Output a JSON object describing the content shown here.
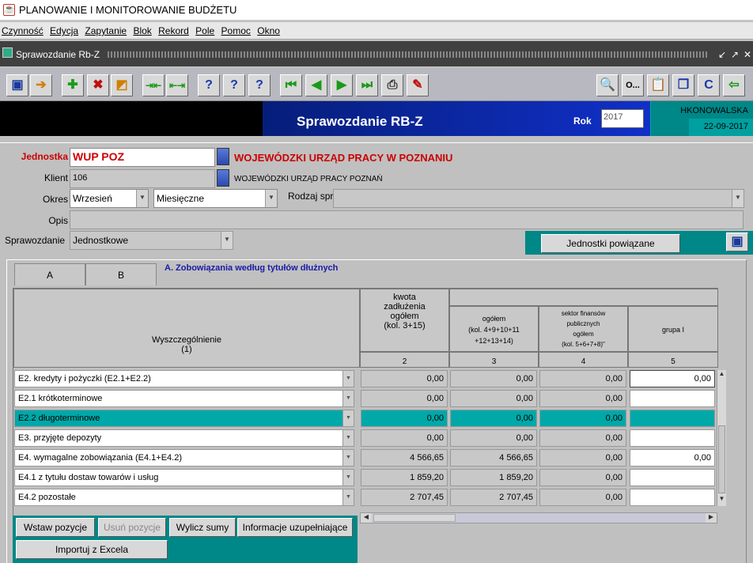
{
  "window": {
    "title": "PLANOWANIE I MONITOROWANIE BUDŻETU"
  },
  "menu": [
    "Czynność",
    "Edycja",
    "Zapytanie",
    "Blok",
    "Rekord",
    "Pole",
    "Pomoc",
    "Okno"
  ],
  "subwindow": {
    "title": "Sprawozdanie Rb-Z"
  },
  "toolbar": {
    "left_icons": [
      "save-icon",
      "exit-icon",
      "insert-record-icon",
      "delete-record-icon",
      "clear-record-icon",
      "collapse-icon",
      "expand-icon",
      "query-icon",
      "execute-query-icon",
      "count-query-icon",
      "first-record-icon",
      "previous-record-icon",
      "next-record-icon",
      "last-record-icon",
      "print-icon",
      "edit-icon"
    ],
    "right_label": "O..."
  },
  "banner": {
    "title": "Sprawozdanie RB-Z",
    "rok_label": "Rok",
    "rok_value": "2017",
    "user": "HKONOWALSKA",
    "date": "22-09-2017"
  },
  "form": {
    "jednostka_label": "Jednostka",
    "jednostka_code": "WUP POZ",
    "jednostka_name": "WOJEWÓDZKI URZĄD PRACY W POZNANIU",
    "klient_label": "Klient",
    "klient_code": "106",
    "klient_name": "WOJEWÓDZKI URZĄD PRACY POZNAŃ",
    "okres_label": "Okres",
    "okres_month": "Wrzesień",
    "okres_type": "Miesięczne",
    "rodzaj_label": "Rodzaj spr.",
    "rodzaj_value": "",
    "opis_label": "Opis",
    "opis_value": "",
    "sprawozdanie_label": "Sprawozdanie",
    "sprawozdanie_value": "Jednostkowe",
    "jednostki_button": "Jednostki powiązane"
  },
  "tabs": [
    "A",
    "B"
  ],
  "section_title": "A. Zobowiązania według tytułów dłużnych",
  "grid": {
    "col1_header": "Wyszczególnienie\n(1)",
    "col2_header": "kwota\nzadłużenia\nogółem\n(kol. 3+15)",
    "col3_header": "ogółem\n(kol. 4+9+10+11\n+12+13+14)",
    "col4_header": "sektor finansów\npublicznych\nogółem\n(kol. 5+6+7+8)\"",
    "col5_header": "grupa I",
    "col_numbers": [
      "2",
      "3",
      "4",
      "5"
    ],
    "rows": [
      {
        "label": "E2. kredyty i pożyczki (E2.1+E2.2)",
        "c2": "0,00",
        "c3": "0,00",
        "c4": "0,00",
        "c5": "0,00"
      },
      {
        "label": "E2.1 krótkoterminowe",
        "c2": "0,00",
        "c3": "0,00",
        "c4": "0,00",
        "c5": ""
      },
      {
        "label": "E2.2 długoterminowe",
        "c2": "0,00",
        "c3": "0,00",
        "c4": "0,00",
        "c5": ""
      },
      {
        "label": "E3. przyjęte depozyty",
        "c2": "0,00",
        "c3": "0,00",
        "c4": "0,00",
        "c5": ""
      },
      {
        "label": "E4.  wymagalne zobowiązania (E4.1+E4.2)",
        "c2": "4 566,65",
        "c3": "4 566,65",
        "c4": "0,00",
        "c5": "0,00"
      },
      {
        "label": "E4.1 z tytułu dostaw towarów i usług",
        "c2": "1 859,20",
        "c3": "1 859,20",
        "c4": "0,00",
        "c5": ""
      },
      {
        "label": "E4.2 pozostałe",
        "c2": "2 707,45",
        "c3": "2 707,45",
        "c4": "0,00",
        "c5": ""
      }
    ]
  },
  "buttons": {
    "wstaw": "Wstaw pozycje",
    "usun": "Usuń pozycje",
    "wylicz": "Wylicz sumy",
    "informacje": "Informacje uzupełniające",
    "importuj": "Importuj z Excela"
  }
}
